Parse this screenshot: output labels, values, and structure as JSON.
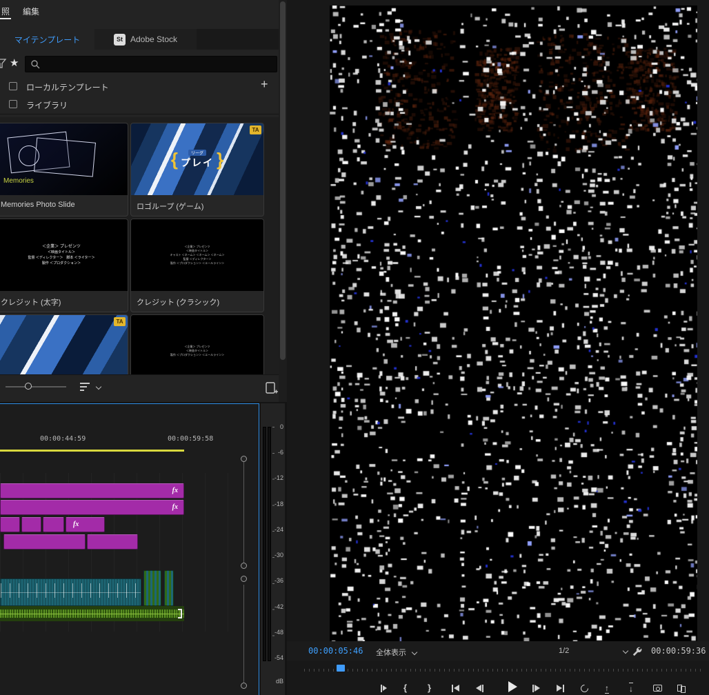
{
  "icons": {
    "star": "★",
    "add": "+",
    "mark_in": "{",
    "mark_out": "}",
    "lift": "↑",
    "extract": "↓"
  },
  "left_panel": {
    "menu": {
      "browse": "照",
      "edit": "編集"
    },
    "tabs": {
      "my_templates": "マイテンプレート",
      "stock_badge": "St",
      "adobe_stock": "Adobe Stock"
    },
    "filters": {
      "local": "ローカルテンプレート",
      "libraries": "ライブラリ"
    },
    "templates": [
      {
        "label": "Memories Photo Slide",
        "thumb_word": "Memories"
      },
      {
        "label": "ロゴループ (ゲーム)",
        "thumb_top": "リーグ",
        "thumb_main": "プレイ",
        "badge": "TA"
      },
      {
        "label": "クレジット (太字)"
      },
      {
        "label": "クレジット (クラシック)"
      },
      {
        "badge": "TA"
      },
      {}
    ],
    "credits_bold": [
      "＜企業＞ プレゼンツ",
      "＜映画タイトル＞",
      "監督 ＜ディレクター＞　脚本 ＜ライター＞",
      "製作 ＜プロダクション＞"
    ],
    "credits_classic": [
      "＜企業＞ プレゼンツ",
      "＜映画タイトル＞",
      "キャスト ＜ネーム＞ ＜ネーム＞ ＜ネーム＞",
      "監督 ＜ディレクター＞",
      "製作 ＜プロダクション＞ ＜エールライン＞"
    ]
  },
  "timeline": {
    "ruler_start": "00:00:44:59",
    "ruler_end": "00:00:59:58",
    "fx": "fx"
  },
  "audio_meter": {
    "ticks": [
      "0",
      "-6",
      "-12",
      "-18",
      "-24",
      "-30",
      "-36",
      "-42",
      "-48",
      "-54"
    ],
    "unit": "dB"
  },
  "program": {
    "current_timecode": "00:00:05:46",
    "fit": "全体表示",
    "playback_resolution": "1/2",
    "duration": "00:00:59:36"
  }
}
